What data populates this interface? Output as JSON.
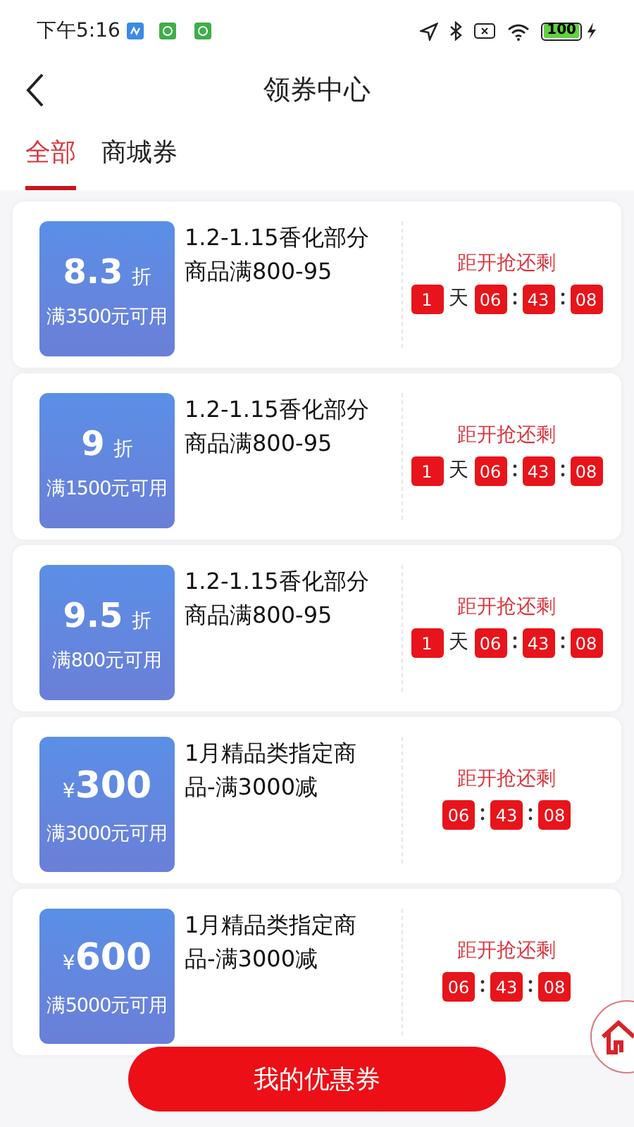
{
  "status_bar": {
    "time": "下午5:16",
    "battery": "100"
  },
  "header": {
    "title": "领券中心"
  },
  "tabs": [
    {
      "label": "全部",
      "selected": true
    },
    {
      "label": "商城券",
      "selected": false
    }
  ],
  "coupons": [
    {
      "kind": "discount",
      "amount": "8.3",
      "unit": "折",
      "condition": "满3500元可用",
      "title": "1.2-1.15香化部分商品满800-95",
      "countdown_label": "距开抢还剩",
      "days": "1",
      "day_unit": "天",
      "hours": "06",
      "minutes": "43",
      "seconds": "08"
    },
    {
      "kind": "discount",
      "amount": "9",
      "unit": "折",
      "condition": "满1500元可用",
      "title": "1.2-1.15香化部分商品满800-95",
      "countdown_label": "距开抢还剩",
      "days": "1",
      "day_unit": "天",
      "hours": "06",
      "minutes": "43",
      "seconds": "08"
    },
    {
      "kind": "discount",
      "amount": "9.5",
      "unit": "折",
      "condition": "满800元可用",
      "title": "1.2-1.15香化部分商品满800-95",
      "countdown_label": "距开抢还剩",
      "days": "1",
      "day_unit": "天",
      "hours": "06",
      "minutes": "43",
      "seconds": "08"
    },
    {
      "kind": "cash",
      "amount": "300",
      "unit": "¥",
      "condition": "满3000元可用",
      "title": "1月精品类指定商品-满3000减",
      "countdown_label": "距开抢还剩",
      "hours": "06",
      "minutes": "43",
      "seconds": "08"
    },
    {
      "kind": "cash",
      "amount": "600",
      "unit": "¥",
      "condition": "满5000元可用",
      "title": "1月精品类指定商品-满3000减",
      "countdown_label": "距开抢还剩",
      "hours": "06",
      "minutes": "43",
      "seconds": "08"
    }
  ],
  "bottom_button": {
    "label": "我的优惠券"
  }
}
